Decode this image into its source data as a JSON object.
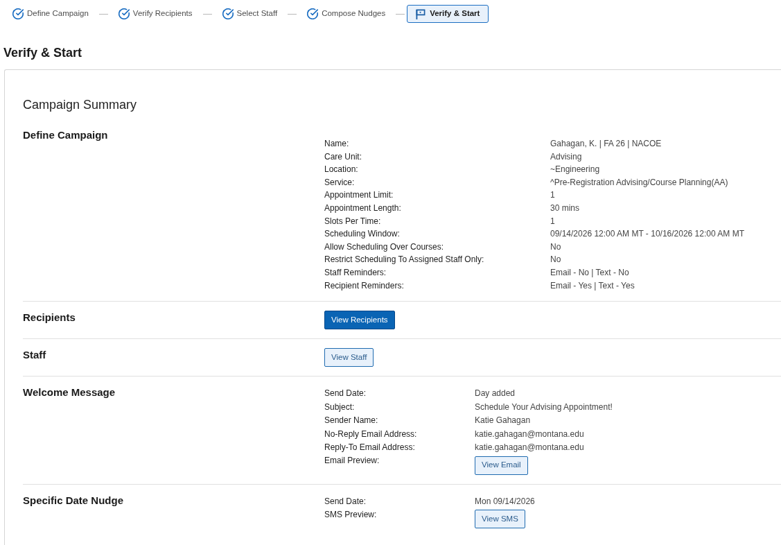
{
  "stepper": {
    "steps": [
      {
        "label": "Define Campaign",
        "completed": true,
        "selected": false
      },
      {
        "label": "Verify Recipients",
        "completed": true,
        "selected": false
      },
      {
        "label": "Select Staff",
        "completed": true,
        "selected": false
      },
      {
        "label": "Compose Nudges",
        "completed": true,
        "selected": false
      },
      {
        "label": "Verify & Start",
        "completed": false,
        "selected": true
      }
    ]
  },
  "page_title": "Verify & Start",
  "summary": {
    "title": "Campaign Summary",
    "sections": [
      {
        "kind": "settings",
        "title": "Define Campaign",
        "rows": [
          {
            "kind": "text",
            "label": "Name:",
            "value": "Gahagan, K. | FA 26 | NACOE"
          },
          {
            "kind": "text",
            "label": "Care Unit:",
            "value": "Advising"
          },
          {
            "kind": "text",
            "label": "Location:",
            "value": "~Engineering"
          },
          {
            "kind": "text",
            "label": "Service:",
            "value": "^Pre-Registration Advising/Course Planning(AA)"
          },
          {
            "kind": "text",
            "label": "Appointment Limit:",
            "value": "1"
          },
          {
            "kind": "text",
            "label": "Appointment Length:",
            "value": "30 mins"
          },
          {
            "kind": "text",
            "label": "Slots Per Time:",
            "value": "1"
          },
          {
            "kind": "text",
            "label": "Scheduling Window:",
            "value": "09/14/2026 12:00 AM MT - 10/16/2026 12:00 AM MT"
          },
          {
            "kind": "text",
            "label": "Allow Scheduling Over Courses:",
            "value": "No"
          },
          {
            "kind": "text",
            "label": "Restrict Scheduling To Assigned Staff Only:",
            "value": "No"
          },
          {
            "kind": "text",
            "label": "Staff Reminders:",
            "value": "Email - No | Text - No"
          },
          {
            "kind": "text",
            "label": "Recipient Reminders:",
            "value": "Email - Yes | Text - Yes"
          }
        ]
      },
      {
        "kind": "action",
        "title": "Recipients",
        "button": "View Recipients"
      },
      {
        "kind": "action",
        "title": "Staff",
        "button": "View Staff"
      },
      {
        "kind": "message",
        "title": "Welcome Message",
        "rows": [
          {
            "kind": "text",
            "label": "Send Date:",
            "value": "Day added"
          },
          {
            "kind": "text",
            "label": "Subject:",
            "value": "Schedule Your Advising Appointment!"
          },
          {
            "kind": "text",
            "label": "Sender Name:",
            "value": "Katie Gahagan"
          },
          {
            "kind": "text",
            "label": "No-Reply Email Address:",
            "value": "katie.gahagan@montana.edu"
          },
          {
            "kind": "text",
            "label": "Reply-To Email Address:",
            "value": "katie.gahagan@montana.edu"
          },
          {
            "kind": "button",
            "label": "Email Preview:",
            "button": "View Email"
          }
        ]
      },
      {
        "kind": "message",
        "title": "Specific Date Nudge",
        "rows": [
          {
            "kind": "text",
            "label": "Send Date:",
            "value": "Mon 09/14/2026"
          },
          {
            "kind": "button",
            "label": "SMS Preview:",
            "button": "View SMS"
          }
        ]
      }
    ]
  }
}
